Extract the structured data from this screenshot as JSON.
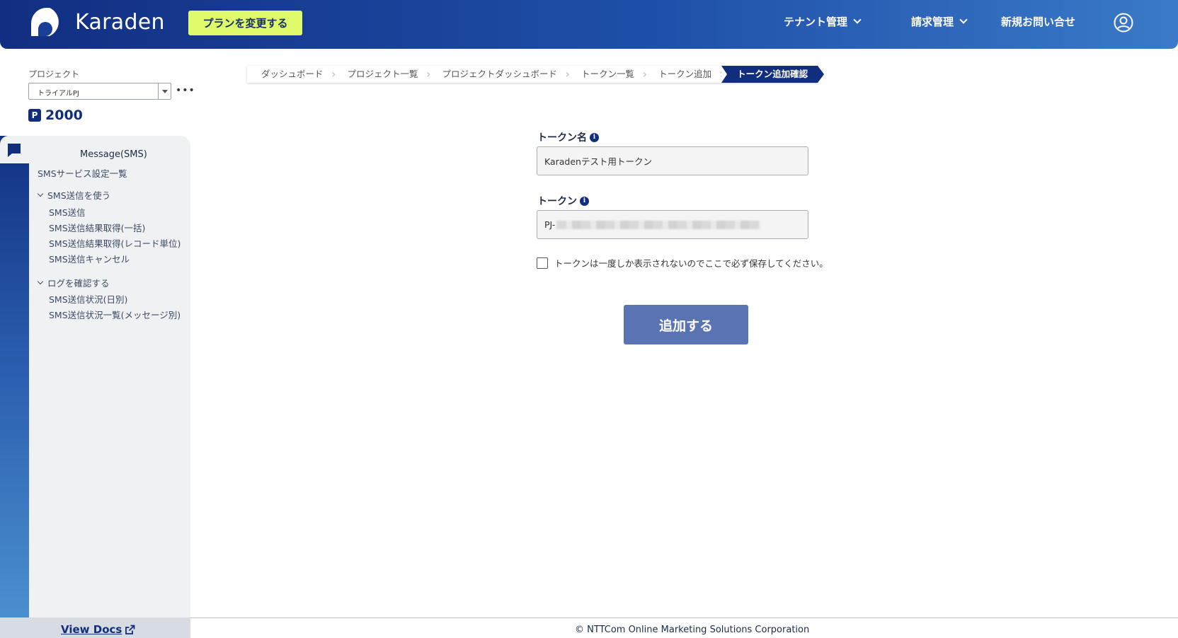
{
  "header": {
    "brand": "Karaden",
    "plan_button": "プランを変更する",
    "nav": [
      "テナント管理",
      "請求管理",
      "新規お問い合せ"
    ],
    "colors": {
      "header_start": "#112e82",
      "header_end": "#3a7ac8",
      "plan_button": "#dffb6a",
      "primary": "#102e7c"
    }
  },
  "sidebar": {
    "project_label": "プロジェクト",
    "project_selected": "トライアルPJ",
    "points_value": "2000",
    "menu_title": "Message(SMS)",
    "service_list": "SMSサービス設定一覧",
    "group_send": "SMS送信を使う",
    "send_items": [
      "SMS送信",
      "SMS送信結果取得(一括)",
      "SMS送信結果取得(レコード単位)",
      "SMS送信キャンセル"
    ],
    "group_logs": "ログを確認する",
    "log_items": [
      "SMS送信状況(日別)",
      "SMS送信状況一覧(メッセージ別)"
    ],
    "docs_link": "View Docs"
  },
  "breadcrumb": [
    "ダッシュボード",
    "プロジェクト一覧",
    "プロジェクトダッシュボード",
    "トークン一覧",
    "トークン追加",
    "トークン追加確認"
  ],
  "form": {
    "token_name_label": "トークン名",
    "token_name_value": "Karadenテスト用トークン",
    "token_label": "トークン",
    "token_prefix": "PJ-",
    "checkbox_label": "トークンは一度しか表示されないのでここで必ず保存してください。",
    "submit_label": "追加する"
  },
  "footer": {
    "copyright": "© NTTCom Online Marketing Solutions Corporation"
  }
}
